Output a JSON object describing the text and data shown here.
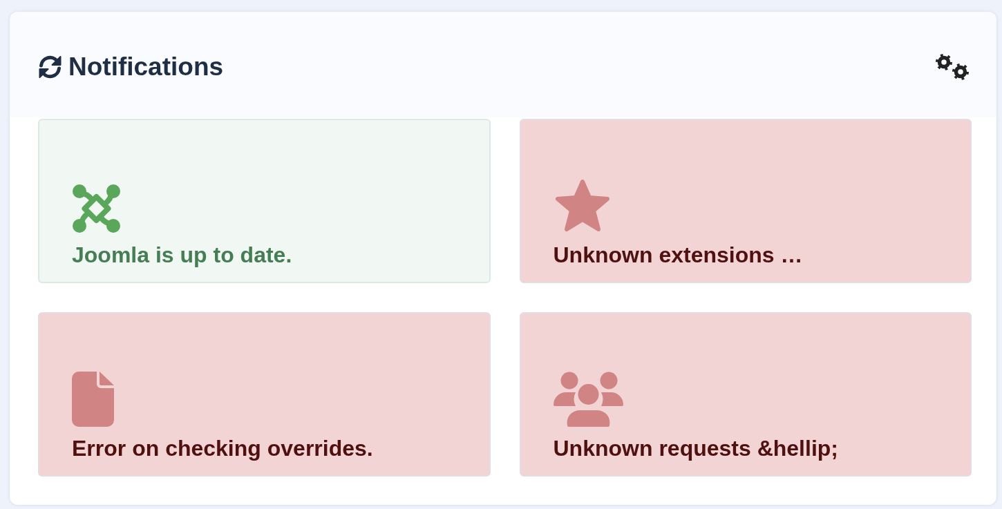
{
  "header": {
    "title": "Notifications"
  },
  "tiles": [
    {
      "kind": "logo",
      "error": false,
      "text": "Joomla is up to date."
    },
    {
      "kind": "star",
      "error": true,
      "text": "Unknown extensions …"
    },
    {
      "kind": "file",
      "error": true,
      "text": "Error on checking overrides."
    },
    {
      "kind": "users",
      "error": true,
      "text": "Unknown requests &hellip;"
    }
  ]
}
